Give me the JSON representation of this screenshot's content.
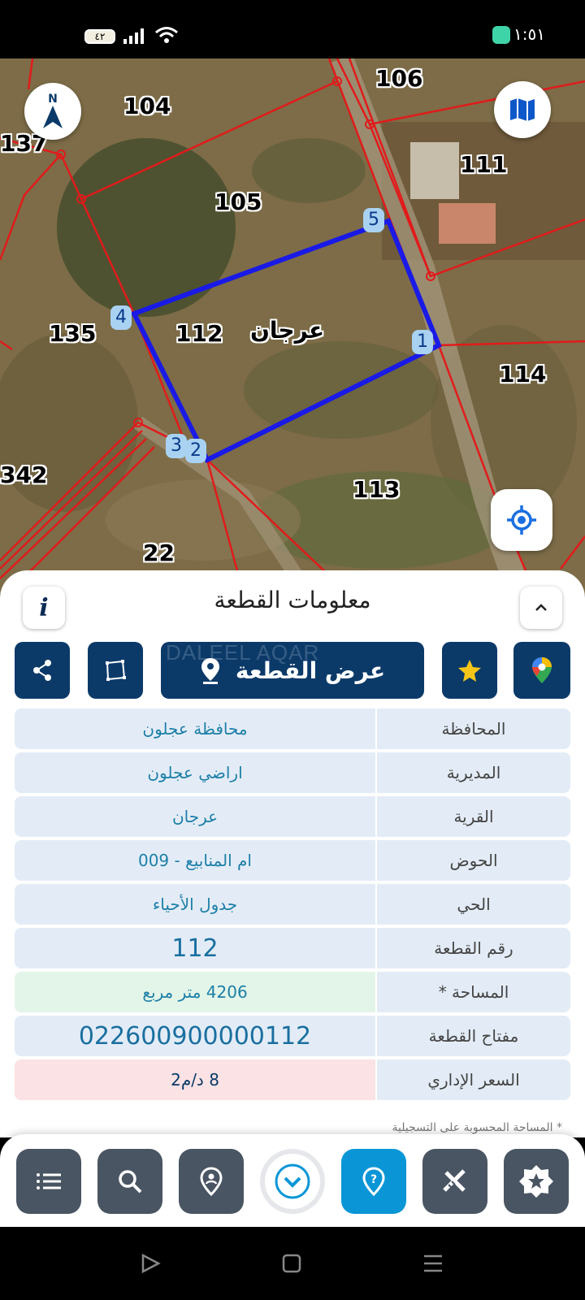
{
  "status_bar": {
    "time": "١:٥١",
    "battery": "٤٢"
  },
  "map": {
    "plot_numbers": [
      "106",
      "104",
      "137",
      "111",
      "105",
      "135",
      "112",
      "114",
      "342",
      "113",
      "22"
    ],
    "village_label": "عرجان",
    "vertices": [
      "1",
      "2",
      "3",
      "4",
      "5"
    ],
    "compass_letter": "N"
  },
  "sheet": {
    "title": "معلومات القطعة",
    "show_plot_label": "عرض القطعة",
    "watermark": "DALEEL AQAR"
  },
  "info_rows": [
    {
      "key": "المحافظة",
      "value": "محافظة عجلون"
    },
    {
      "key": "المديرية",
      "value": "اراضي عجلون"
    },
    {
      "key": "القرية",
      "value": "عرجان"
    },
    {
      "key": "الحوض",
      "value": "ام المنابيع - 009"
    },
    {
      "key": "الحي",
      "value": "جدول الأحياء"
    },
    {
      "key": "رقم القطعة",
      "value": "112"
    },
    {
      "key": "المساحة *",
      "value": "4206  متر مربع"
    },
    {
      "key": "مفتاح القطعة",
      "value": "022600900000112"
    },
    {
      "key": "السعر الإداري",
      "value": "8 د/م2"
    }
  ],
  "footnote": "* المساحة المحسوبة على التسجيلية",
  "colors": {
    "primary": "#0b3a69",
    "accent": "#0a96d6",
    "parcel_lines": "#e11b1b",
    "selected_parcel": "#1a1ae6"
  }
}
